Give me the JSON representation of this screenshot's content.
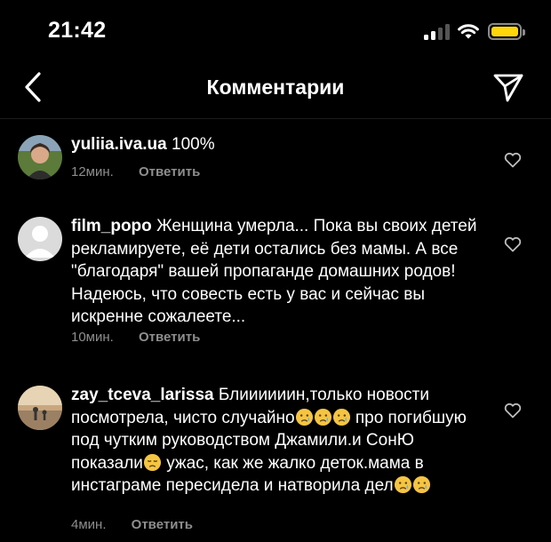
{
  "status": {
    "time": "21:42"
  },
  "header": {
    "title": "Комментарии"
  },
  "comments": [
    {
      "username": "yuliia.iva.ua",
      "text": "100%",
      "time": "12мин.",
      "reply_label": "Ответить"
    },
    {
      "username": "film_popo",
      "text": "Женщина умерла... Пока вы своих детей рекламируете, её дети остались без мамы. А все \"благодаря\" вашей пропаганде домашних родов! Надеюсь, что совесть есть у вас и сейчас вы искренне сожалеете...",
      "time": "10мин.",
      "reply_label": "Ответить"
    },
    {
      "username": "zay_tceva_larissa",
      "text_part1": "Блиииииин,только новости посмотрела, чисто случайно",
      "text_part2": " про погибшую под чутким руководством Джамили.и СонЮ показали",
      "text_part3": " ужас, как же жалко деток.мама в инстаграме пересидела и натворила  дел",
      "emoji_names": [
        "crying-face",
        "disappointed-face"
      ],
      "time": "4мин.",
      "reply_label": "Ответить"
    }
  ],
  "colors": {
    "background": "#000000",
    "secondary_text": "#8e8e8e",
    "battery": "#ffd60a"
  },
  "icons": [
    "back-chevron-icon",
    "send-icon",
    "heart-icon",
    "signal-icon",
    "wifi-icon",
    "battery-icon"
  ]
}
